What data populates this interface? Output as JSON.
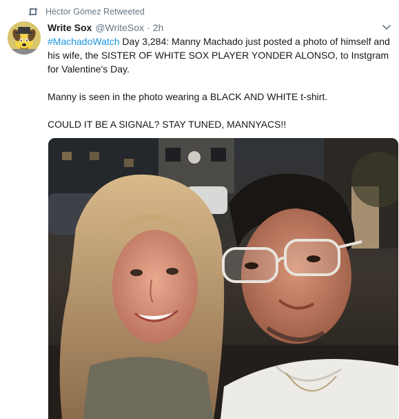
{
  "retweet_context": {
    "icon": "retweet-icon",
    "text": "Héctor Gómez Retweeted"
  },
  "author": {
    "fullname": "Write Sox",
    "username": "@WriteSox",
    "separator": "·",
    "time": "2h",
    "avatar_icon": "dog-avatar"
  },
  "tweet": {
    "hashtag": "#MachadoWatch",
    "line1_rest": " Day 3,284: Manny Machado just posted a photo of himself and his wife, the SISTER OF WHITE SOX PLAYER YONDER ALONSO, to Instgram for Valentine's Day.",
    "paragraph2": "Manny is seen in the photo wearing a BLACK AND WHITE t-shirt.",
    "paragraph3": "COULD IT BE A SIGNAL? STAY TUNED, MANNYACS!!"
  },
  "colors": {
    "link": "#1b95e0",
    "secondary_text": "#657786",
    "primary_text": "#14171a"
  },
  "menu_icon": "chevron-down-icon",
  "media": {
    "type": "photo"
  }
}
